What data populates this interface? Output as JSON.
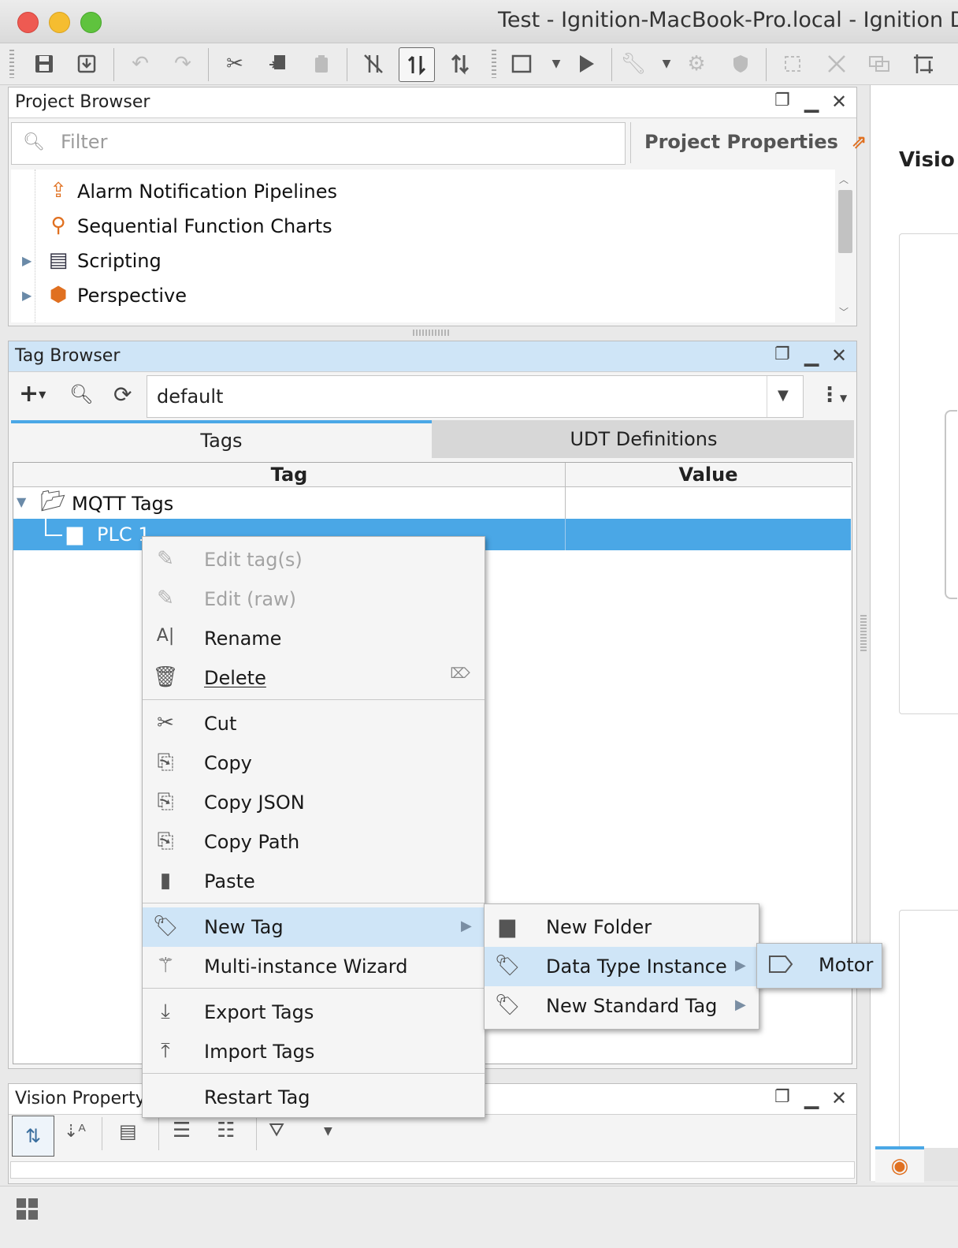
{
  "window": {
    "title": "Test - Ignition-MacBook-Pro.local - Ignition Desi"
  },
  "toolbar": {
    "icons": [
      "save-icon",
      "save-all-icon",
      "undo-icon",
      "redo-icon",
      "cut-icon",
      "copy-icon",
      "paste-icon",
      "comm-off-icon",
      "comm-read-icon",
      "comm-write-icon",
      "window-icon",
      "play-icon",
      "wrench-icon",
      "gear-shield-icon",
      "security-icon",
      "align-icon",
      "distribute-icon",
      "group-icon",
      "layout-icon"
    ]
  },
  "project_browser": {
    "title": "Project Browser",
    "filter_placeholder": "Filter",
    "properties_label": "Project Properties",
    "items": [
      {
        "label": "Alarm Notification Pipelines",
        "icon": "pipeline-icon",
        "expandable": false
      },
      {
        "label": "Sequential Function Charts",
        "icon": "sfc-icon",
        "expandable": false
      },
      {
        "label": "Scripting",
        "icon": "script-icon",
        "expandable": true
      },
      {
        "label": "Perspective",
        "icon": "perspective-icon",
        "expandable": true
      }
    ]
  },
  "right_panel": {
    "label": "Visio"
  },
  "tag_browser": {
    "title": "Tag Browser",
    "provider": "default",
    "tabs": [
      "Tags",
      "UDT Definitions"
    ],
    "active_tab": "Tags",
    "columns": [
      "Tag",
      "Value"
    ],
    "rows": [
      {
        "label": "MQTT Tags",
        "level": 0,
        "expanded": true,
        "selected": false
      },
      {
        "label": "PLC 1",
        "level": 1,
        "expanded": false,
        "selected": true
      }
    ]
  },
  "context_menu": {
    "items": [
      {
        "label": "Edit tag(s)",
        "icon": "pencil-icon",
        "disabled": true
      },
      {
        "label": "Edit (raw)",
        "icon": "pencil-icon",
        "disabled": true
      },
      {
        "label": "Rename",
        "icon": "rename-icon",
        "disabled": false
      },
      {
        "label": "Delete",
        "icon": "trash-icon",
        "disabled": false,
        "shortcut_icon": "delete-key-icon"
      },
      {
        "label": "Cut",
        "icon": "scissors-icon",
        "disabled": false
      },
      {
        "label": "Copy",
        "icon": "copy-icon",
        "disabled": false
      },
      {
        "label": "Copy JSON",
        "icon": "copy-json-icon",
        "disabled": false
      },
      {
        "label": "Copy Path",
        "icon": "copy-path-icon",
        "disabled": false
      },
      {
        "label": "Paste",
        "icon": "clipboard-icon",
        "disabled": false
      },
      {
        "label": "New Tag",
        "icon": "new-tag-icon",
        "disabled": false,
        "submenu": true,
        "highlighted": true
      },
      {
        "label": "Multi-instance Wizard",
        "icon": "wand-icon",
        "disabled": false
      },
      {
        "label": "Export Tags",
        "icon": "export-icon",
        "disabled": false
      },
      {
        "label": "Import Tags",
        "icon": "import-icon",
        "disabled": false
      },
      {
        "label": "Restart Tag",
        "icon": "",
        "disabled": false
      }
    ]
  },
  "submenu_new_tag": {
    "items": [
      {
        "label": "New Folder",
        "icon": "folder-icon",
        "submenu": false
      },
      {
        "label": "Data Type Instance",
        "icon": "udt-instance-icon",
        "submenu": true,
        "highlighted": true
      },
      {
        "label": "New Standard Tag",
        "icon": "new-tag-icon",
        "submenu": true
      }
    ]
  },
  "submenu_data_type": {
    "items": [
      {
        "label": "Motor",
        "icon": "udt-tag-icon"
      }
    ]
  },
  "vision_property_editor": {
    "title": "Vision Property E"
  },
  "colors": {
    "selection": "#4aa7e6",
    "highlight": "#cfe5f7",
    "tab_underline": "#4aa7e6"
  }
}
